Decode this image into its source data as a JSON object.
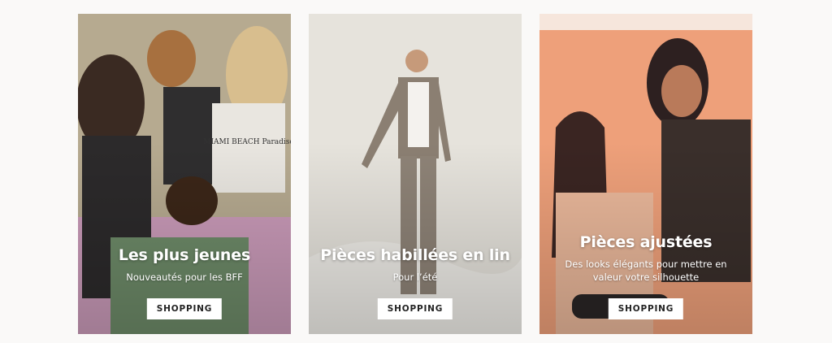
{
  "cards": [
    {
      "title": "Les plus jeunes",
      "subtitle": "Nouveautés pour les BFF",
      "button": "SHOPPING",
      "shirt_print": "MIAMI BEACH Paradise"
    },
    {
      "title": "Pièces habillées en lin",
      "subtitle": "Pour l’été",
      "button": "SHOPPING"
    },
    {
      "title": "Pièces ajustées",
      "subtitle": "Des looks élégants pour mettre en valeur votre silhouette",
      "button": "SHOPPING"
    }
  ]
}
